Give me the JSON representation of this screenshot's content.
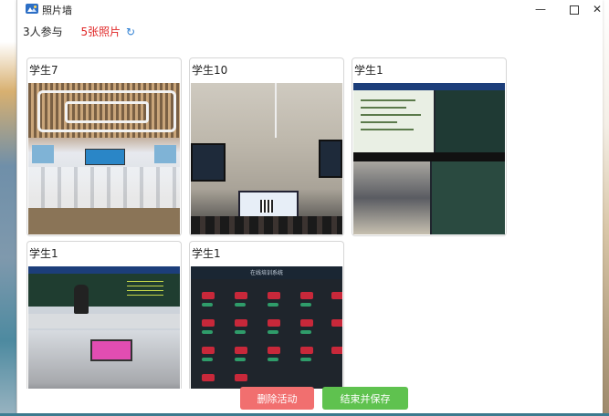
{
  "window": {
    "title": "照片墙",
    "controls": {
      "minimize": "—",
      "maximize": "",
      "close": "✕"
    }
  },
  "stats": {
    "participants": "3人参与",
    "photo_count": "5张照片",
    "refresh_icon": "refresh-icon"
  },
  "photos": [
    {
      "label": "学生7",
      "scene": "classroom"
    },
    {
      "label": "学生10",
      "scene": "lecture-hall"
    },
    {
      "label": "学生1",
      "scene": "split-screen"
    },
    {
      "label": "学生1",
      "scene": "teacher-board"
    },
    {
      "label": "学生1",
      "scene": "online-course",
      "header_text": "在线培训系统"
    }
  ],
  "actions": {
    "delete_label": "删除活动",
    "finish_label": "结束并保存"
  },
  "colors": {
    "accent_red": "#e02424",
    "refresh_blue": "#2d7fd3",
    "delete_button": "#f16f6f",
    "finish_button": "#5fc24f"
  }
}
